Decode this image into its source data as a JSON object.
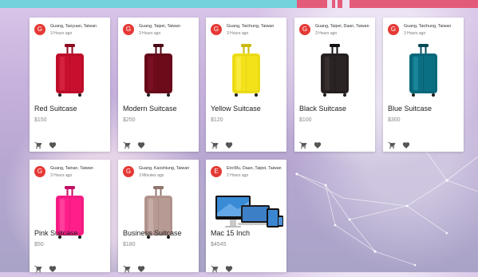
{
  "colors": {
    "avatar": "#e53935",
    "topbar_teal": "#73d3dc",
    "topbar_pink": "#e45b7a"
  },
  "cards": [
    {
      "initial": "G",
      "location": "Guang, Taoyuan, Taiwan",
      "time": "3 Hours ago",
      "title": "Red Suitcase",
      "price": "$150",
      "image": "suitcase-red"
    },
    {
      "initial": "G",
      "location": "Guang, Taipei, Taiwan",
      "time": "3 Hours ago",
      "title": "Modern Suitcase",
      "price": "$250",
      "image": "suitcase-maroon"
    },
    {
      "initial": "G",
      "location": "Guang, Taichung, Taiwan",
      "time": "3 Hours ago",
      "title": "Yellow Suitcase",
      "price": "$120",
      "image": "suitcase-yellow"
    },
    {
      "initial": "G",
      "location": "Guang, Taipei, Daan, Taiwan",
      "time": "3 Hours ago",
      "title": "Black Suitcase",
      "price": "$100",
      "image": "suitcase-black"
    },
    {
      "initial": "G",
      "location": "Guang, Taichung, Taiwan",
      "time": "3 Hours ago",
      "title": "Blue Suitcase",
      "price": "$300",
      "image": "suitcase-blue"
    },
    {
      "initial": "G",
      "location": "Guang, Tainan, Taiwan",
      "time": "3 Hours ago",
      "title": "Pink Suitcase",
      "price": "$50",
      "image": "suitcase-pink"
    },
    {
      "initial": "G",
      "location": "Guang, Kaoshiung, Taiwan",
      "time": "3 Minutes ago",
      "title": "Business Suitcase",
      "price": "$180",
      "image": "suitcase-silver"
    },
    {
      "initial": "E",
      "location": "EricWu, Daan, Taipei, Taiwan",
      "time": "2 Hours ago",
      "title": "Mac 15 Inch",
      "price": "$4545",
      "image": "apple-devices"
    }
  ]
}
